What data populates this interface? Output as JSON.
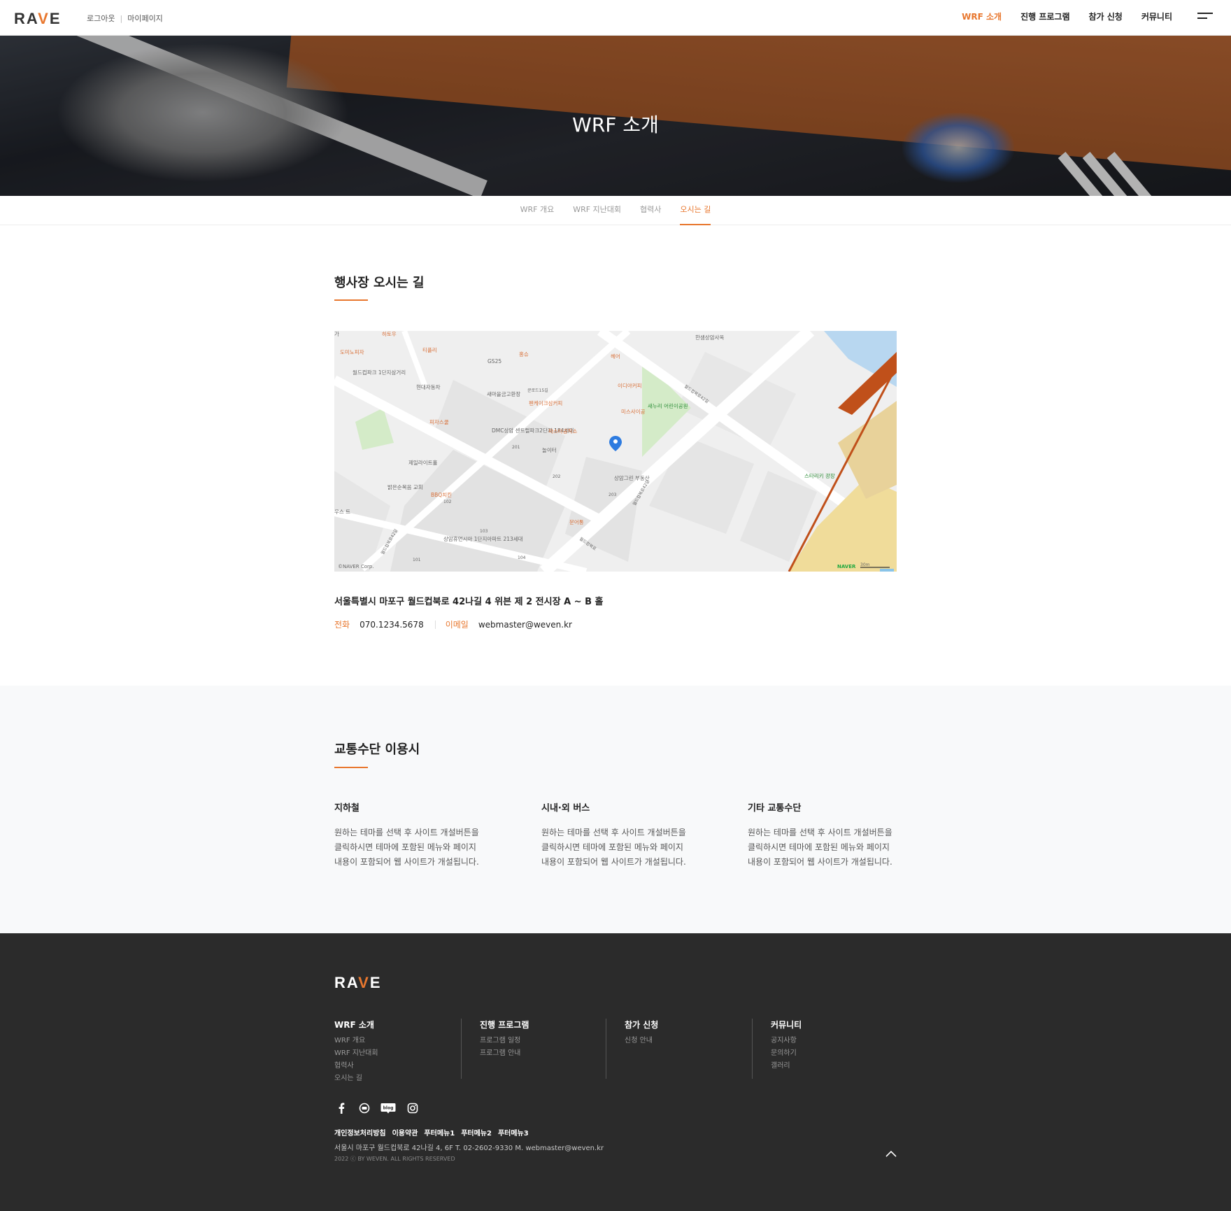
{
  "header": {
    "logo": "RAVE",
    "util": [
      "로그아웃",
      "마이페이지"
    ],
    "nav": [
      "WRF 소개",
      "진행 프로그램",
      "참가 신청",
      "커뮤니티"
    ],
    "active_nav": "WRF 소개"
  },
  "hero": {
    "title": "WRF 소개"
  },
  "subtabs": {
    "items": [
      "WRF 개요",
      "WRF 지난대회",
      "협력사",
      "오시는 길"
    ],
    "active": "오시는 길"
  },
  "location": {
    "title": "행사장 오시는 길",
    "map": {
      "labels": [
        "가",
        "하토우",
        "도미노피자",
        "티플리",
        "GS25",
        "홍슈",
        "헤어",
        "한샘상암사옥",
        "월드컵파크 1단지삼거리",
        "현대자동차",
        "새마을금고환장",
        "쿤로드15길",
        "펜케이크삼커피",
        "이디야커피",
        "미스사이공",
        "새누리 어린이공원",
        "피자스쿨",
        "DMC상암 센트럴파크2단지 184세대",
        "파스타공작소",
        "놀이터",
        "제일라이트홀",
        "상암그린 부동산",
        "밝은순복음 교회",
        "BBQ치킨",
        "우스 트",
        "문어통",
        "상암휴먼시아 1단지아파트 213세대",
        "월드컵북로42길",
        "월드컵북로",
        "월드컵북로42길",
        "월드컵북로42길",
        "스타리키 광장",
        "©NAVER Corp.",
        "NAVER",
        "30m"
      ],
      "numbers": [
        "201",
        "202",
        "203",
        "102",
        "103",
        "101",
        "104"
      ]
    },
    "address": "서울특별시 마포구 월드컵북로 42나길 4 위븐 제 2 전시장 A ~ B 홀",
    "phone_label": "전화",
    "phone": "070.1234.5678",
    "email_label": "이메일",
    "email": "webmaster@weven.kr"
  },
  "transport": {
    "title": "교통수단 이용시",
    "columns": [
      {
        "title": "지하철",
        "lines": [
          "원하는 테마를 선택 후 사이트 개설버튼을",
          "클릭하시면 테마에 포함된 메뉴와 페이지",
          "내용이 포함되어 웹 사이트가 개설됩니다."
        ]
      },
      {
        "title": "시내·외 버스",
        "lines": [
          "원하는 테마를 선택 후 사이트 개설버튼을",
          "클릭하시면 테마에 포함된 메뉴와 페이지",
          "내용이 포함되어 웹 사이트가 개설됩니다."
        ]
      },
      {
        "title": "기타 교통수단",
        "lines": [
          "원하는 테마를 선택 후 사이트 개설버튼을",
          "클릭하시면 테마에 포함된 메뉴와 페이지",
          "내용이 포함되어 웹 사이트가 개설됩니다."
        ]
      }
    ]
  },
  "footer": {
    "logo": "RAVE",
    "columns": [
      {
        "title": "WRF 소개",
        "items": [
          "WRF 개요",
          "WRF 지난대회",
          "협력사",
          "오시는 길"
        ]
      },
      {
        "title": "진행 프로그램",
        "items": [
          "프로그램 일정",
          "프로그램 안내"
        ]
      },
      {
        "title": "참가 신청",
        "items": [
          "신청 안내"
        ]
      },
      {
        "title": "커뮤니티",
        "items": [
          "공지사항",
          "문의하기",
          "갤러리"
        ]
      }
    ],
    "social": [
      "facebook-icon",
      "youtube-icon",
      "blog-icon",
      "instagram-icon"
    ],
    "blog_text": "blog",
    "links": [
      "개인정보처리방침",
      "이용약관",
      "푸터메뉴1",
      "푸터메뉴2",
      "푸터메뉴3"
    ],
    "info": "서울시 마포구 월드컵북로 42나길 4, 6F   T. 02-2602-9330 M. webmaster@weven.kr",
    "copyright": "2022 ⓒ BY WEVEN. ALL RIGHTS RESERVED"
  },
  "colors": {
    "accent": "#e8772e",
    "footer_bg": "#2b2b2b",
    "section_bg": "#f8f9fa"
  }
}
